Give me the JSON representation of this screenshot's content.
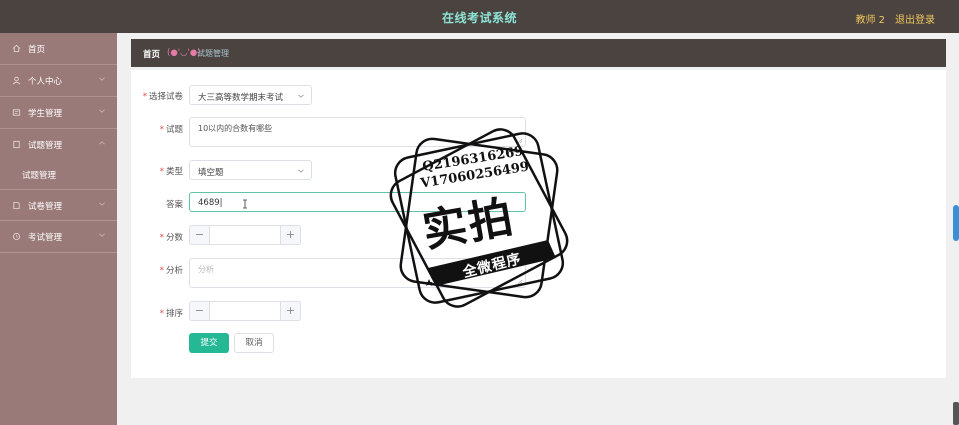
{
  "header": {
    "title": "在线考试系统",
    "user": "教师 2",
    "logout": "退出登录"
  },
  "sidebar": {
    "items": [
      {
        "label": "首页",
        "icon": "home-icon"
      },
      {
        "label": "个人中心",
        "icon": "user-icon"
      },
      {
        "label": "学生管理",
        "icon": "students-icon"
      },
      {
        "label": "试题管理",
        "icon": "questions-icon",
        "expanded": true
      },
      {
        "label": "试卷管理",
        "icon": "paper-icon"
      },
      {
        "label": "考试管理",
        "icon": "exam-icon"
      }
    ],
    "subitem": "试题管理"
  },
  "breadcrumb": {
    "home": "首页",
    "emoji": "(●'◡'●)",
    "current": "试题管理"
  },
  "form": {
    "paper": {
      "label": "选择试卷",
      "value": "大三高等数学期末考试"
    },
    "question": {
      "label": "试题",
      "value": "10以内的合数有哪些"
    },
    "type": {
      "label": "类型",
      "value": "填空题"
    },
    "answer": {
      "label": "答案",
      "value": "4689|"
    },
    "score": {
      "label": "分数",
      "value": ""
    },
    "analysis": {
      "label": "分析",
      "placeholder": "分析"
    },
    "order": {
      "label": "排序",
      "value": ""
    },
    "submit": "提交",
    "cancel": "取消"
  },
  "watermark": {
    "line1": "Q2196316269",
    "line2": "V17060256499",
    "big": "实拍",
    "small": "全微程序"
  },
  "colors": {
    "topbar": "#4a4340",
    "sidebar": "#9a7a78",
    "title": "#8de3d4",
    "user": "#f0c75e",
    "primary": "#25b895"
  }
}
